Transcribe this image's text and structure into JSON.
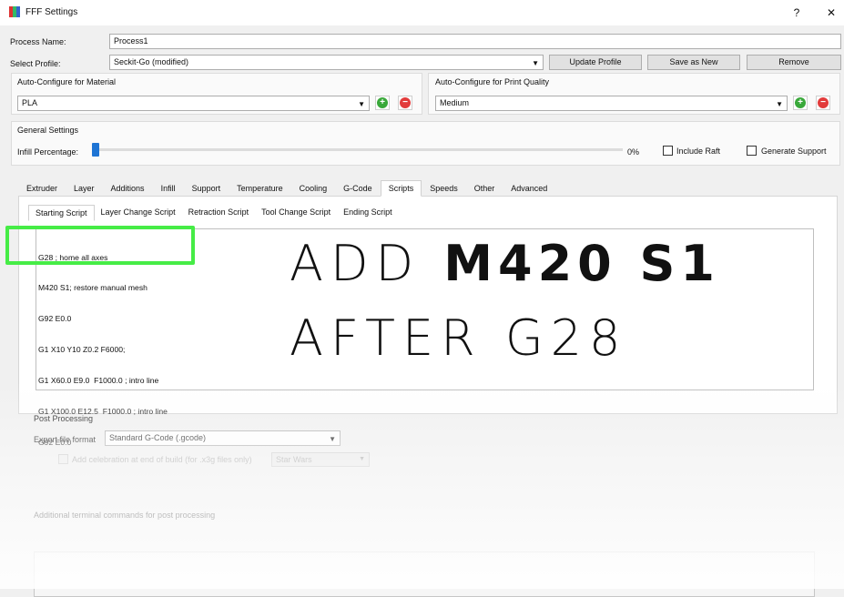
{
  "window": {
    "title": "FFF Settings",
    "help_label": "?",
    "close_label": "✕",
    "icon_colors": [
      "#d33",
      "#3b6",
      "#36c"
    ]
  },
  "process": {
    "name_label": "Process Name:",
    "name_value": "Process1",
    "profile_label": "Select Profile:",
    "profile_value": "Seckit-Go (modified)",
    "update_profile": "Update Profile",
    "save_as_new": "Save as New",
    "remove": "Remove"
  },
  "material": {
    "label": "Auto-Configure for Material",
    "value": "PLA"
  },
  "quality": {
    "label": "Auto-Configure for Print Quality",
    "value": "Medium"
  },
  "general": {
    "label": "General Settings",
    "infill_label": "Infill Percentage:",
    "infill_value": "0%",
    "infill_fraction": 0.0,
    "include_raft": "Include Raft",
    "generate_support": "Generate Support"
  },
  "tabs": [
    "Extruder",
    "Layer",
    "Additions",
    "Infill",
    "Support",
    "Temperature",
    "Cooling",
    "G-Code",
    "Scripts",
    "Speeds",
    "Other",
    "Advanced"
  ],
  "active_tab": "Scripts",
  "subtabs": [
    "Starting Script",
    "Layer Change Script",
    "Retraction Script",
    "Tool Change Script",
    "Ending Script"
  ],
  "active_subtab": "Starting Script",
  "script_lines": [
    "G28 ; home all axes",
    "M420 S1; restore manual mesh",
    "G92 E0.0",
    "G1 X10 Y10 Z0.2 F6000;",
    "G1 X60.0 E9.0  F1000.0 ; intro line",
    "G1 X100.0 E12.5  F1000.0 ; intro line",
    "G92 E0.0"
  ],
  "overlay": {
    "line1_thin": "ADD ",
    "line1_bold": "M420 S1",
    "line2": "AFTER G28"
  },
  "post": {
    "label": "Post Processing",
    "export_label": "Export file format",
    "export_value": "Standard G-Code (.gcode)",
    "celebration_label": "Add celebration at end of build (for .x3g files only)",
    "celebration_value": "Star Wars",
    "terminal_label": "Additional terminal commands for post processing"
  },
  "colors": {
    "highlight": "#46ec46",
    "slider": "#1e74d4",
    "plus": "#39a83a",
    "minus": "#e23b3b"
  }
}
